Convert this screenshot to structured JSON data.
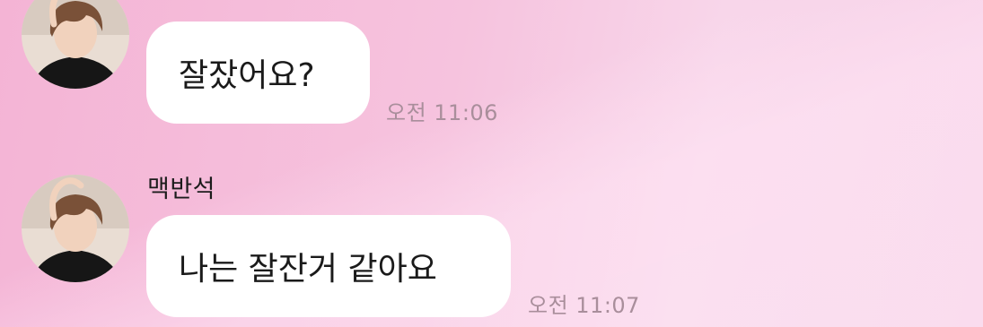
{
  "colors": {
    "background": "#f5bcd9",
    "bubble": "#ffffff",
    "timestamp": "#a98e9b",
    "name": "#1c1c1c"
  },
  "messages": [
    {
      "sender": "",
      "avatar_icon": "profile-photo",
      "text": "잘잤어요?",
      "time": "오전 11:06"
    },
    {
      "sender": "맥반석",
      "avatar_icon": "profile-photo",
      "text": "나는 잘잔거 같아요",
      "time": "오전 11:07"
    }
  ]
}
